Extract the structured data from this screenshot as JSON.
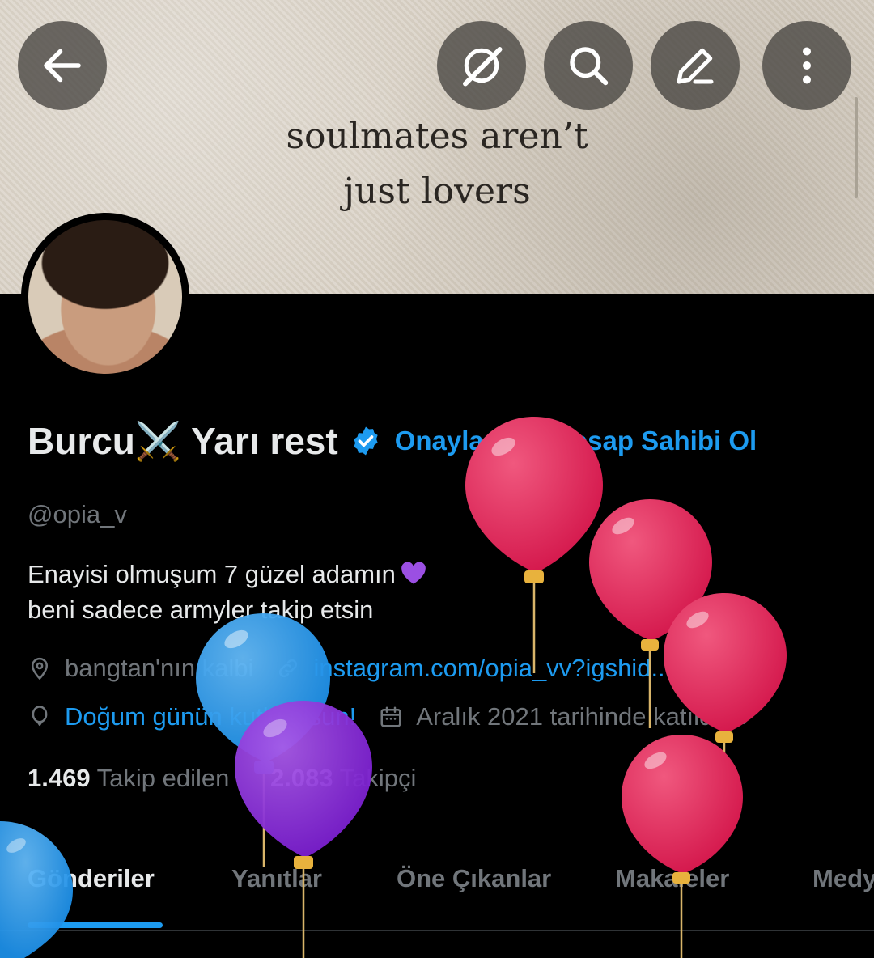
{
  "banner": {
    "line1": "soulmates aren’t",
    "line2": "just lovers"
  },
  "topbar": {
    "back_icon": "arrow-left-icon",
    "grok_icon": "grok-icon",
    "search_icon": "search-icon",
    "edit_icon": "edit-icon",
    "more_icon": "more-vertical-icon"
  },
  "profile": {
    "name": "Burcu⚔️ Yarı rest",
    "verify_cta": "Onaylanmış Hesap Sahibi Ol",
    "handle": "@opia_v",
    "bio_line1": "Enayisi olmuşum 7 güzel adamın",
    "bio_line2": "beni sadece armyler takip etsin",
    "location": "bangtan'nın kalbi",
    "website": "instagram.com/opia_vv?igshid...",
    "birthday": "Doğum günün kutlu olsun!",
    "joined": "Aralık 2021 tarihinde katıldı",
    "following_count": "1.469",
    "following_label": "Takip edilen",
    "followers_count": "2.083",
    "followers_label": "Takipçi"
  },
  "tabs": [
    {
      "label": "Gönderiler"
    },
    {
      "label": "Yanıtlar"
    },
    {
      "label": "Öne Çıkanlar"
    },
    {
      "label": "Makaleler"
    },
    {
      "label": "Medya"
    }
  ],
  "colors": {
    "accent": "#1d9bf0",
    "muted": "#71767b",
    "text": "#e7e9ea",
    "balloon_red": "#e0265a",
    "balloon_blue": "#2f9ff0",
    "balloon_purple": "#8c2fd6"
  }
}
